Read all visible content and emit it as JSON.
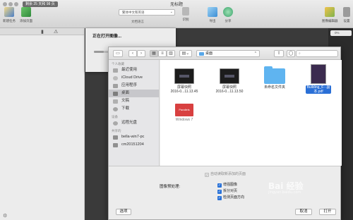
{
  "window": {
    "title": "无标题",
    "trial_badge": "剩余 25 天和 98 页"
  },
  "toolbar": {
    "new_doc_label": "新建任务",
    "add_page_label": "添加页面",
    "language_value": "繁体中文和英语",
    "language_label": "文档语言",
    "recognize_label": "识别",
    "export_label": "导出",
    "share_label": "分享",
    "edit_label": "图像编辑器",
    "settings_label": "设置"
  },
  "right_strip": {
    "zoom": "0%"
  },
  "progress": {
    "title": "正在打开图像...",
    "fraction": 0.35
  },
  "dialog": {
    "location": "桌面",
    "search_placeholder": "",
    "sidebar": {
      "favorites_header": "个人收藏",
      "favorites": [
        "最近使用",
        "iCloud Drive",
        "应用程序",
        "桌面",
        "文稿",
        "下载"
      ],
      "devices_header": "设备",
      "devices": [
        "远程光盘"
      ],
      "shared_header": "共享的",
      "shared": [
        "bella-win7-pc",
        "cm20151204"
      ]
    },
    "files": [
      {
        "name_line1": "屏幕快照",
        "name_line2": "2016-0...11.13.45"
      },
      {
        "name_line1": "屏幕快照",
        "name_line2": "2016-0...11.13.50"
      },
      {
        "name_line1": "未命名文件夹",
        "name_line2": ""
      },
      {
        "name_line1": "Building_6 - 副",
        "name_line2": "本.pdf"
      },
      {
        "name_line1": "Windows 7",
        "name_line2": ""
      }
    ],
    "auto_read_label": "自动读取新添加的页面",
    "preprocess_label": "图像预处理:",
    "options": [
      "增强图像",
      "拆分对页",
      "检测页面方向"
    ],
    "options_button": "选项",
    "cancel_button": "取消",
    "open_button": "打开"
  },
  "watermark": {
    "text": "Bai 经验",
    "sub": "jingyan.baidu.com"
  },
  "colors": {
    "accent": "#2a72d8",
    "folder": "#5fb4f0"
  }
}
